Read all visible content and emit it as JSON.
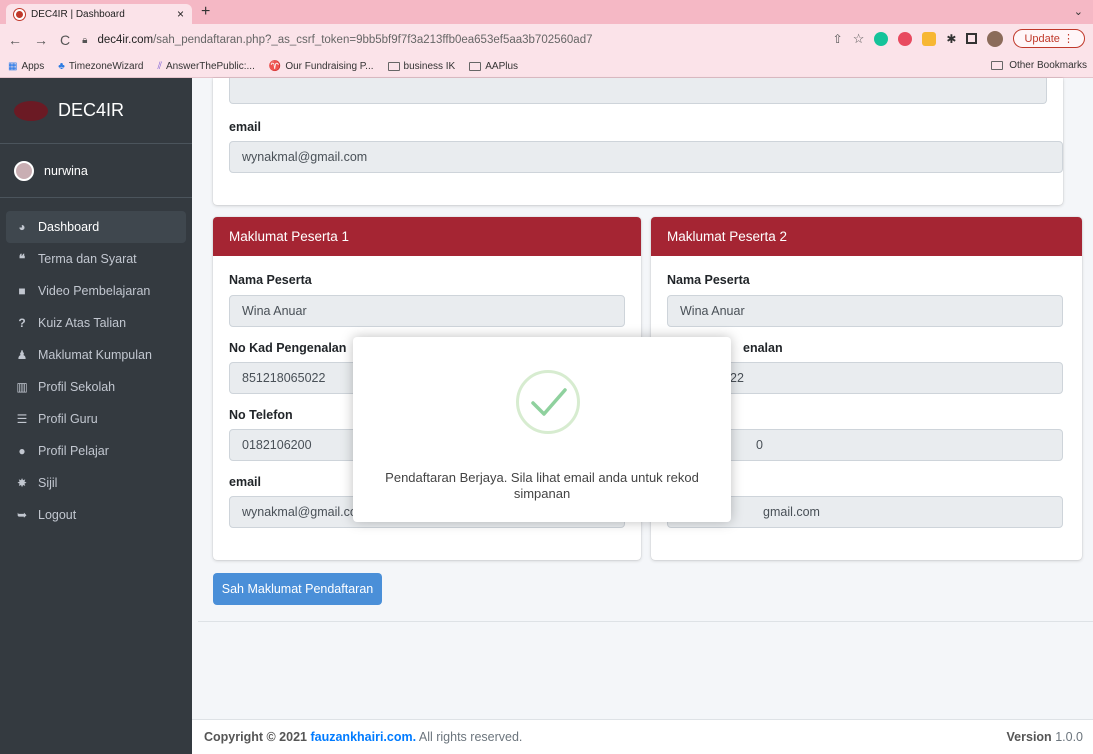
{
  "browser": {
    "tab_title": "DEC4IR | Dashboard",
    "tab_close": "×",
    "new_tab": "+",
    "tab_menu": "⌄",
    "url_host": "dec4ir.com",
    "url_path": "/sah_pendaftaran.php?_as_csrf_token=9bb5bf9f7f3a213ffb0ea653ef5aa3b702560ad7",
    "update_label": "Update",
    "bookmarks": [
      {
        "label": "Apps"
      },
      {
        "label": "TimezoneWizard"
      },
      {
        "label": "AnswerThePublic:..."
      },
      {
        "label": "Our Fundraising P..."
      },
      {
        "label": "business IK"
      },
      {
        "label": "AAPlus"
      }
    ],
    "other_bookmarks": "Other Bookmarks"
  },
  "sidebar": {
    "brand": "DEC4IR",
    "user": "nurwina",
    "items": [
      {
        "label": "Dashboard",
        "icon": "tachometer-icon"
      },
      {
        "label": "Terma dan Syarat",
        "icon": "quote-icon"
      },
      {
        "label": "Video Pembelajaran",
        "icon": "video-icon"
      },
      {
        "label": "Kuiz Atas Talian",
        "icon": "question-icon"
      },
      {
        "label": "Maklumat Kumpulan",
        "icon": "users-icon"
      },
      {
        "label": "Profil Sekolah",
        "icon": "building-icon"
      },
      {
        "label": "Profil Guru",
        "icon": "server-icon"
      },
      {
        "label": "Profil Pelajar",
        "icon": "user-circle-icon"
      },
      {
        "label": "Sijil",
        "icon": "certificate-icon"
      },
      {
        "label": "Logout",
        "icon": "logout-icon"
      }
    ]
  },
  "top_card": {
    "email_label": "email",
    "email_value": "wynakmal@gmail.com"
  },
  "participants": [
    {
      "header": "Maklumat Peserta 1",
      "name_label": "Nama Peserta",
      "name_value": "Wina Anuar",
      "ic_label": "No Kad Pengenalan",
      "ic_value": "851218065022",
      "phone_label": "No Telefon",
      "phone_value": "0182106200",
      "email_label": "email",
      "email_value": "wynakmal@gmail.co"
    },
    {
      "header": "Maklumat Peserta 2",
      "name_label": "Nama Peserta",
      "name_value": "Wina Anuar",
      "ic_label": "enalan",
      "ic_value": "22",
      "phone_value": "0",
      "email_value": "gmail.com"
    }
  ],
  "submit_button": "Sah Maklumat Pendaftaran",
  "modal": {
    "message": "Pendaftaran Berjaya. Sila lihat email anda untuk rekod simpanan"
  },
  "footer": {
    "copyright_prefix": "Copyright © 2021",
    "site": "fauzankhairi.com.",
    "suffix": "All rights reserved.",
    "version_label": "Version",
    "version_value": "1.0.0"
  },
  "colors": {
    "sidebar_bg": "#343a40",
    "card_header": "#a52533",
    "primary_button": "#4a8fd8",
    "success_check": "#8fd19e"
  }
}
